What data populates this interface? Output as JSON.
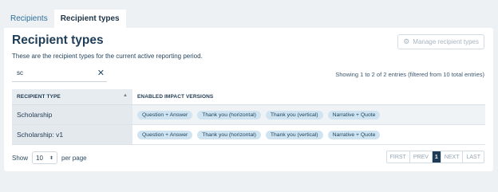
{
  "tabs": [
    {
      "label": "Recipients"
    },
    {
      "label": "Recipient types"
    }
  ],
  "header": {
    "title": "Recipient types",
    "subtitle": "These are the recipient types for the current active reporting period.",
    "manage_button": "Manage recipient types"
  },
  "search": {
    "value": "sc",
    "clear_icon": "close-icon"
  },
  "showing_text": "Showing 1 to 2 of 2 entries (filtered from 10 total entries)",
  "table": {
    "columns": [
      "RECIPIENT TYPE",
      "ENABLED IMPACT VERSIONS"
    ],
    "rows": [
      {
        "name": "Scholarship",
        "versions": [
          "Question + Answer",
          "Thank you (horizontal)",
          "Thank you (vertical)",
          "Narrative + Quote"
        ]
      },
      {
        "name": "Scholarship: v1",
        "versions": [
          "Question + Answer",
          "Thank you (horizontal)",
          "Thank you (vertical)",
          "Narrative + Quote"
        ]
      }
    ]
  },
  "footer": {
    "show_label": "Show",
    "page_size": "10",
    "per_page_label": "per page",
    "pager": [
      "FIRST",
      "PREV",
      "1",
      "NEXT",
      "LAST"
    ]
  }
}
